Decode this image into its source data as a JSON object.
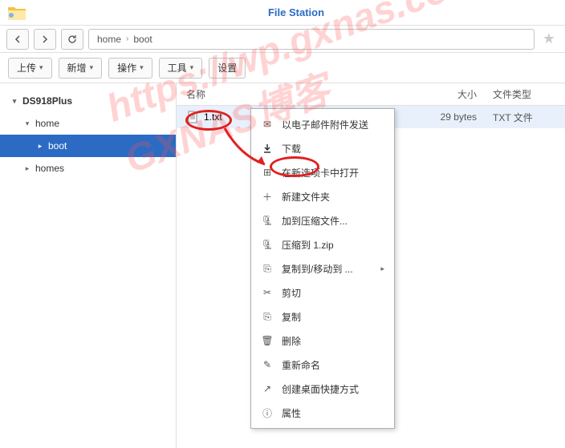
{
  "header": {
    "title": "File Station"
  },
  "breadcrumb": {
    "items": [
      "home",
      "boot"
    ]
  },
  "toolbar": {
    "upload": "上传",
    "new": "新增",
    "action": "操作",
    "tools": "工具",
    "settings": "设置"
  },
  "tree": {
    "root": "DS918Plus",
    "home": "home",
    "boot": "boot",
    "homes": "homes"
  },
  "columns": {
    "name": "名称",
    "size": "大小",
    "type": "文件类型"
  },
  "file": {
    "name": "1.txt",
    "size": "29 bytes",
    "type": "TXT 文件"
  },
  "menu": {
    "send_email": "以电子邮件附件发送",
    "download": "下载",
    "open_new_tab": "在新选项卡中打开",
    "new_folder": "新建文件夹",
    "add_archive": "加到压缩文件...",
    "compress_to": "压缩到 1.zip",
    "copy_move": "复制到/移动到 ...",
    "cut": "剪切",
    "copy": "复制",
    "delete": "删除",
    "rename": "重新命名",
    "shortcut": "创建桌面快捷方式",
    "properties": "属性"
  },
  "watermark": "https://wp.gxnas.com GXNAS博客"
}
